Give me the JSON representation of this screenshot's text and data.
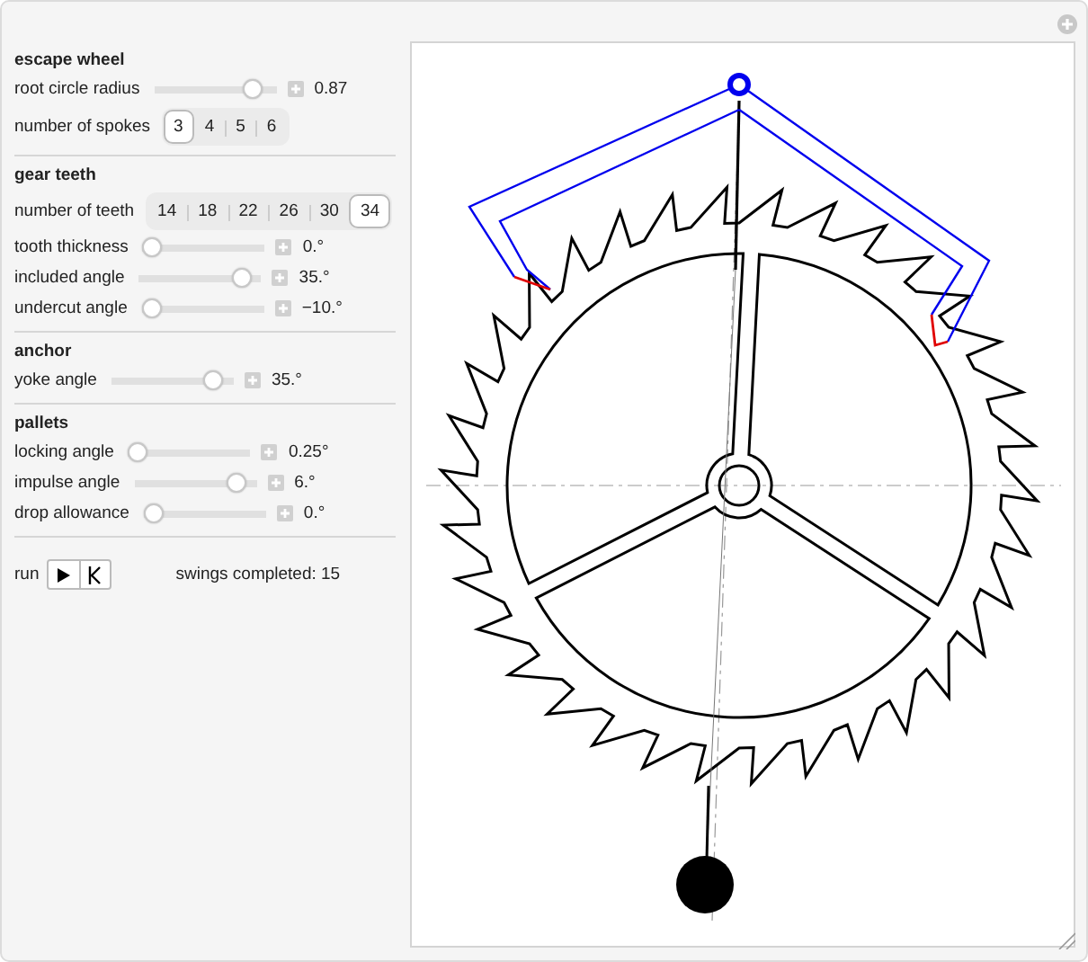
{
  "sections": [
    {
      "title": "escape wheel",
      "controls": [
        {
          "kind": "slider",
          "label": "root circle radius",
          "level": 0.87,
          "value": "0.87"
        },
        {
          "kind": "setter",
          "label": "number of spokes",
          "options": [
            {
              "label": "3",
              "selected": true
            },
            {
              "label": "4",
              "selected": false
            },
            {
              "label": "5",
              "selected": false
            },
            {
              "label": "6",
              "selected": false
            }
          ]
        }
      ]
    },
    {
      "title": "gear teeth",
      "controls": [
        {
          "kind": "setter",
          "label": "number of teeth",
          "options": [
            {
              "label": "14",
              "selected": false
            },
            {
              "label": "18",
              "selected": false
            },
            {
              "label": "22",
              "selected": false
            },
            {
              "label": "26",
              "selected": false
            },
            {
              "label": "30",
              "selected": false
            },
            {
              "label": "34",
              "selected": true
            }
          ]
        },
        {
          "kind": "slider",
          "label": "tooth thickness",
          "level": 0,
          "value": "0.°"
        },
        {
          "kind": "slider",
          "label": "included angle",
          "level": 0.9,
          "value": "35.°"
        },
        {
          "kind": "slider",
          "label": "undercut angle",
          "level": 0,
          "value": "−10.°"
        }
      ]
    },
    {
      "title": "anchor",
      "controls": [
        {
          "kind": "slider",
          "label": "yoke angle",
          "level": 0.9,
          "value": "35.°"
        }
      ]
    },
    {
      "title": "pallets",
      "controls": [
        {
          "kind": "slider",
          "label": "locking angle",
          "level": 0,
          "value": "0.25°"
        },
        {
          "kind": "slider",
          "label": "impulse angle",
          "level": 0.9,
          "value": "6.°"
        },
        {
          "kind": "slider",
          "label": "drop allowance",
          "level": 0,
          "value": "0.°"
        }
      ]
    }
  ],
  "run": {
    "label": "run",
    "status": "swings completed: 15"
  }
}
